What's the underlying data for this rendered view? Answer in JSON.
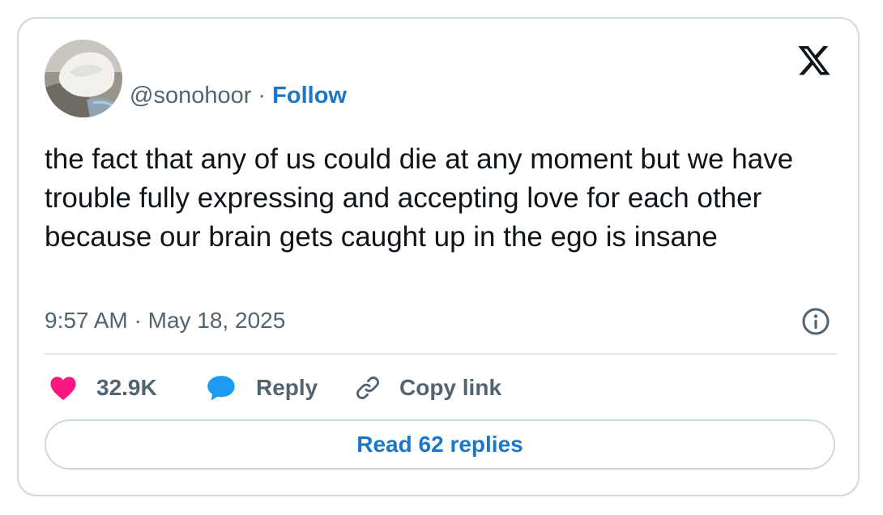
{
  "author": {
    "handle": "@sonohoor",
    "separator": " · ",
    "follow_label": "Follow",
    "avatar_icon": "user-avatar-photo"
  },
  "brand": {
    "icon": "x-logo-icon",
    "color": "#0f1419"
  },
  "tweet": {
    "text": "the fact that any of us could die at any moment but we have trouble fully expressing and accepting love for each other because our brain gets caught up in the ego is insane",
    "timestamp": "9:57 AM · May 18, 2025"
  },
  "actions": {
    "like_count": "32.9K",
    "like_icon": "heart-icon",
    "like_color": "#f91880",
    "reply_label": "Reply",
    "reply_icon": "speech-bubble-icon",
    "reply_color": "#1d9bf0",
    "copy_label": "Copy link",
    "copy_icon": "link-icon"
  },
  "footer": {
    "read_replies_label": "Read 62 replies"
  },
  "colors": {
    "accent": "#1d76c6",
    "muted": "#536471",
    "text": "#0f1419",
    "border": "#cfd9de"
  }
}
